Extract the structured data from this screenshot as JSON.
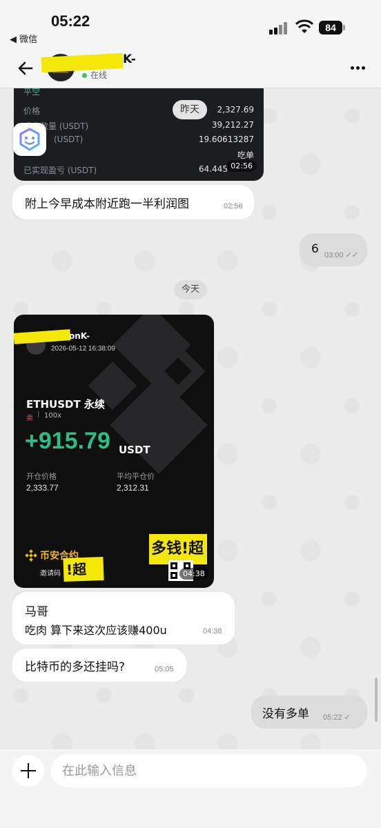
{
  "status": {
    "time": "05:22",
    "back_app": "◀ 微信",
    "battery": "84"
  },
  "header": {
    "contact_name": "K-",
    "online": "在线"
  },
  "top_card": {
    "tag": "平空",
    "rows": [
      {
        "label": "价格",
        "value": "2,327.69"
      },
      {
        "label": "成交数量 (USDT)",
        "value": "39,212.27"
      },
      {
        "label": "(USDT)",
        "value": "19.60613287"
      },
      {
        "label": "",
        "value": "吃单"
      },
      {
        "label": "已实现盈亏 (USDT)",
        "value": "64.445"
      }
    ],
    "time": "02:56",
    "yesterday": "昨天"
  },
  "messages": {
    "m1": {
      "text": "附上今早成本附近跑一半利润图",
      "time": "02:56"
    },
    "m2": {
      "text": "6",
      "time": "03:00"
    },
    "day": "今天",
    "m3": {
      "line1": "马哥",
      "line2": "吃肉 算下来这次应该赚400u",
      "time": "04:38"
    },
    "m4": {
      "text": "比特币的多还挂吗?",
      "time": "05:05"
    },
    "m5": {
      "text": "没有多单",
      "time": "05:22"
    }
  },
  "trade_card": {
    "user": "onK-",
    "datetime": "2026-05-12 16:38:09",
    "pair": "ETHUSDT 永续",
    "side": "卖",
    "leverage": "100x",
    "pnl": "+915.79",
    "pnl_unit": "USDT",
    "open_label": "开仓价格",
    "open_value": "2,333.77",
    "close_label": "平均平仓价",
    "close_value": "2,312.31",
    "brand": "币安合约",
    "invite": "邀请码",
    "invite_redacted": "!超",
    "stamp_text": "多钱!超",
    "time": "04:38",
    "colors": {
      "pnl": "#2ebd85",
      "side": "#f6465d",
      "brand": "#f0b90b"
    }
  },
  "input": {
    "placeholder": "在此输入信息"
  }
}
